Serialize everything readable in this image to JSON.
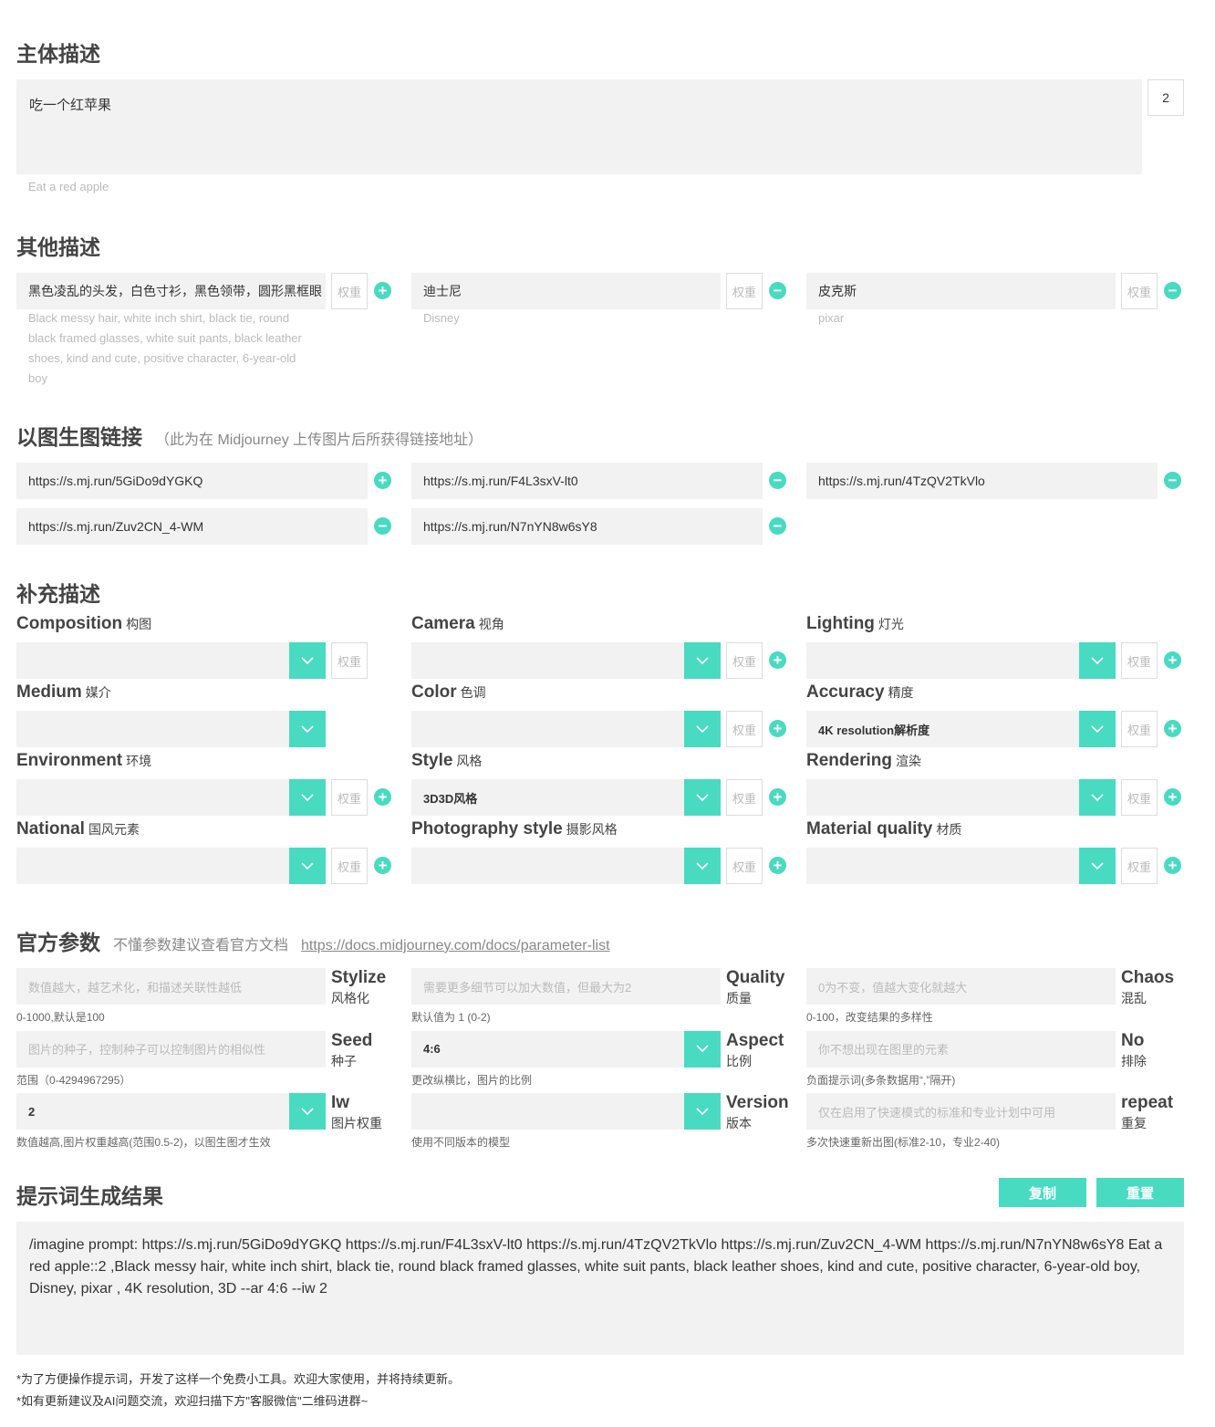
{
  "main": {
    "title": "主体描述",
    "text": "吃一个红苹果",
    "weight": "2",
    "translation": "Eat a red apple"
  },
  "other": {
    "title": "其他描述",
    "weight_placeholder": "权重",
    "items": [
      {
        "text": "黑色凌乱的头发，白色寸衫，黑色领带，圆形黑框眼",
        "translation": "Black messy hair, white inch shirt, black tie, round black framed glasses, white suit pants, black leather shoes, kind and cute, positive character, 6-year-old boy",
        "action": "+"
      },
      {
        "text": "迪士尼",
        "translation": "Disney",
        "action": "−"
      },
      {
        "text": "皮克斯",
        "translation": "pixar",
        "action": "−"
      }
    ]
  },
  "img2img": {
    "title": "以图生图链接",
    "subtitle": "（此为在 Midjourney 上传图片后所获得链接地址）",
    "links": [
      {
        "url": "https://s.mj.run/5GiDo9dYGKQ",
        "action": "+"
      },
      {
        "url": "https://s.mj.run/F4L3sxV-lt0",
        "action": "−"
      },
      {
        "url": "https://s.mj.run/4TzQV2TkVlo",
        "action": "−"
      },
      {
        "url": "https://s.mj.run/Zuv2CN_4-WM",
        "action": "−"
      },
      {
        "url": "https://s.mj.run/N7nYN8w6sY8",
        "action": "−"
      }
    ]
  },
  "supp": {
    "title": "补充描述",
    "weight_placeholder": "权重",
    "items": [
      {
        "en": "Composition",
        "cn": "构图",
        "value": "",
        "weight": true,
        "plus": false
      },
      {
        "en": "Camera",
        "cn": "视角",
        "value": "",
        "weight": true,
        "plus": true
      },
      {
        "en": "Lighting",
        "cn": "灯光",
        "value": "",
        "weight": true,
        "plus": true
      },
      {
        "en": "Medium",
        "cn": "媒介",
        "value": "",
        "weight": false,
        "plus": false
      },
      {
        "en": "Color",
        "cn": "色调",
        "value": "",
        "weight": true,
        "plus": true
      },
      {
        "en": "Accuracy",
        "cn": "精度",
        "value": "4K resolution解析度",
        "weight": true,
        "plus": true
      },
      {
        "en": "Environment",
        "cn": "环境",
        "value": "",
        "weight": true,
        "plus": true
      },
      {
        "en": "Style",
        "cn": "风格",
        "value": "3D3D风格",
        "weight": true,
        "plus": true
      },
      {
        "en": "Rendering",
        "cn": "渲染",
        "value": "",
        "weight": true,
        "plus": true
      },
      {
        "en": "National",
        "cn": "国风元素",
        "value": "",
        "weight": true,
        "plus": true
      },
      {
        "en": "Photography style",
        "cn": "摄影风格",
        "value": "",
        "weight": true,
        "plus": true
      },
      {
        "en": "Material quality",
        "cn": "材质",
        "value": "",
        "weight": true,
        "plus": true
      }
    ]
  },
  "params": {
    "title": "官方参数",
    "subtitle": "不懂参数建议查看官方文档",
    "link": "https://docs.midjourney.com/docs/parameter-list",
    "items": [
      {
        "en": "Stylize",
        "cn": "风格化",
        "value": "",
        "placeholder": "数值越大，越艺术化，和描述关联性越低",
        "hint": "0-1000,默认是100",
        "dropdown": false
      },
      {
        "en": "Quality",
        "cn": "质量",
        "value": "",
        "placeholder": "需要更多细节可以加大数值，但最大为2",
        "hint": "默认值为 1 (0-2)",
        "dropdown": false
      },
      {
        "en": "Chaos",
        "cn": "混乱",
        "value": "",
        "placeholder": "0为不变，值越大变化就越大",
        "hint": "0-100，改变结果的多样性",
        "dropdown": false
      },
      {
        "en": "Seed",
        "cn": "种子",
        "value": "",
        "placeholder": "图片的种子，控制种子可以控制图片的相似性",
        "hint": "范围（0-4294967295）",
        "dropdown": false
      },
      {
        "en": "Aspect",
        "cn": "比例",
        "value": "4:6",
        "placeholder": "",
        "hint": "更改纵横比，图片的比例",
        "dropdown": true
      },
      {
        "en": "No",
        "cn": "排除",
        "value": "",
        "placeholder": "你不想出现在图里的元素",
        "hint": "负面提示词(多条数据用“,”隔开)",
        "dropdown": false
      },
      {
        "en": "Iw",
        "cn": "图片权重",
        "value": "2",
        "placeholder": "",
        "hint": "数值越高,图片权重越高(范围0.5-2)，以图生图才生效",
        "dropdown": true
      },
      {
        "en": "Version",
        "cn": "版本",
        "value": "",
        "placeholder": "",
        "hint": "使用不同版本的模型",
        "dropdown": true
      },
      {
        "en": "repeat",
        "cn": "重复",
        "value": "",
        "placeholder": "仅在启用了快速模式的标准和专业计划中可用",
        "hint": "多次快速重新出图(标准2-10，专业2-40)",
        "dropdown": false
      }
    ]
  },
  "result": {
    "title": "提示词生成结果",
    "copy_label": "复制",
    "reset_label": "重置",
    "text": "/imagine prompt: https://s.mj.run/5GiDo9dYGKQ https://s.mj.run/F4L3sxV-lt0 https://s.mj.run/4TzQV2TkVlo https://s.mj.run/Zuv2CN_4-WM https://s.mj.run/N7nYN8w6sY8 Eat a red apple::2 ,Black messy hair, white inch shirt, black tie, round black framed glasses, white suit pants, black leather shoes, kind and cute, positive character, 6-year-old boy, Disney, pixar , 4K resolution, 3D --ar 4:6 --iw 2"
  },
  "footer": {
    "line1": "*为了方便操作提示词，开发了这样一个免费小工具。欢迎大家使用，并将持续更新。",
    "line2": "*如有更新建议及AI问题交流，欢迎扫描下方\"客服微信\"二维码进群~"
  },
  "colors": {
    "accent": "#48dbc1",
    "field": "#f2f2f2"
  }
}
